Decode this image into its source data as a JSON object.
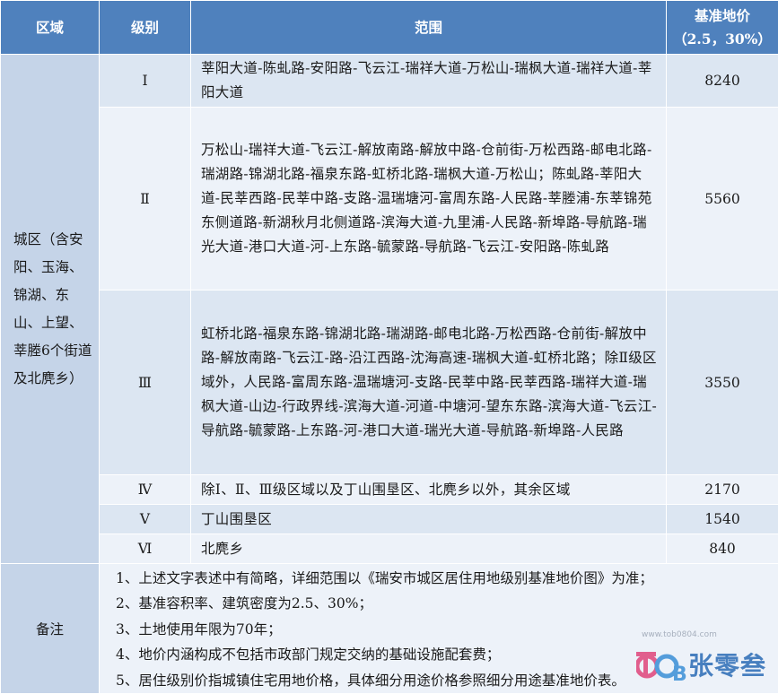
{
  "header": {
    "region": "区域",
    "level": "级别",
    "range": "范围",
    "price_line1": "基准地价",
    "price_line2": "（2.5，30%）"
  },
  "region_label": "城区（含安阳、玉海、锦湖、东山、上望、莘塍6个街道及北麂乡）",
  "rows": [
    {
      "level": "Ⅰ",
      "range": "莘阳大道-陈虬路-安阳路-飞云江-瑞祥大道-万松山-瑞枫大道-瑞祥大道-莘阳大道",
      "price": "8240"
    },
    {
      "level": "Ⅱ",
      "range": "万松山-瑞祥大道-飞云江-解放南路-解放中路-仓前街-万松西路-邮电北路-瑞湖路-锦湖北路-福泉东路-虹桥北路-瑞枫大道-万松山；陈虬路-莘阳大道-民莘西路-民莘中路-支路-温瑞塘河-富周东路-人民路-莘塍浦-东莘锦苑东侧道路-新湖秋月北侧道路-滨海大道-九里浦-人民路-新埠路-导航路-瑞光大道-港口大道-河-上东路-毓蒙路-导航路-飞云江-安阳路-陈虬路",
      "price": "5560"
    },
    {
      "level": "Ⅲ",
      "range": "虹桥北路-福泉东路-锦湖北路-瑞湖路-邮电北路-万松西路-仓前街-解放中路-解放南路-飞云江-路-沿江西路-沈海高速-瑞枫大道-虹桥北路；除Ⅱ级区域外，人民路-富周东路-温瑞塘河-支路-民莘中路-民莘西路-瑞祥大道-瑞枫大道-山边-行政界线-滨海大道-河道-中塘河-望东东路-滨海大道-飞云江-导航路-毓蒙路-上东路-河-港口大道-瑞光大道-导航路-新埠路-人民路",
      "price": "3550"
    },
    {
      "level": "Ⅳ",
      "range": "除Ⅰ、Ⅱ、Ⅲ级区域以及丁山围垦区、北麂乡以外，其余区域",
      "price": "2170"
    },
    {
      "level": "Ⅴ",
      "range": "丁山围垦区",
      "price": "1540"
    },
    {
      "level": "Ⅵ",
      "range": "北麂乡",
      "price": "840"
    }
  ],
  "notes_label": "备注",
  "notes": [
    "1、上述文字表述中有简略，详细范围以《瑞安市城区居住用地级别基准地价图》为准；",
    "2、基准容积率、建筑密度为2.5、30%；",
    "3、土地使用年限为70年；",
    "4、地价内涵构成不包括市政部门规定交纳的基础设施配套费；",
    "5、居住级别价指城镇住宅用地价格，具体细分用途价格参照细分用途基准地价表。"
  ],
  "watermark": {
    "logo": "TOB",
    "text": "张零叁",
    "url": "www.tob0804.com"
  },
  "colors": {
    "header_bg": "#4f81bd",
    "row_dark": "#c5d4e8",
    "row_mid": "#dce6f2",
    "row_light": "#edf2f9"
  }
}
